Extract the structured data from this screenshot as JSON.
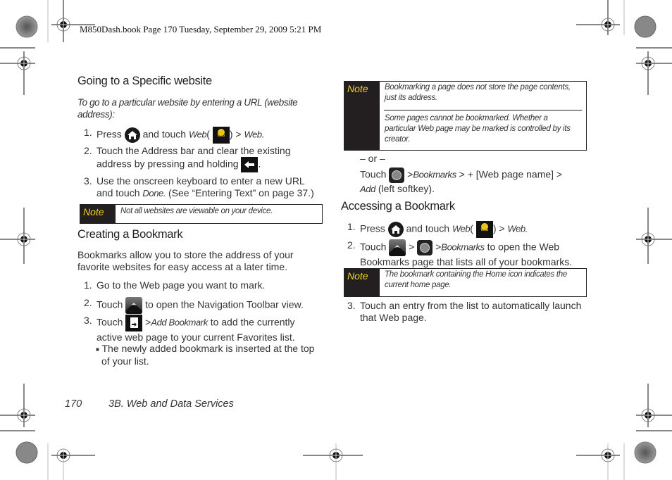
{
  "slug": "M850Dash.book  Page 170  Tuesday, September 29, 2009  5:21 PM",
  "left": {
    "section1": {
      "heading": "Going to a Specific website",
      "intro_line1": "To go to a particular website by entering a URL (website",
      "intro_line2": "address):",
      "steps": [
        {
          "num": "1.",
          "a": "Press",
          "b": "and touch",
          "c": "Web",
          "d": "(",
          "e": ") >",
          "f": "Web."
        },
        {
          "num": "2.",
          "line1": "Touch the Address bar and clear the existing",
          "line2": "address by pressing and holding",
          "end": "."
        },
        {
          "num": "3.",
          "line1": "Use the onscreen keyboard to enter a new URL",
          "line2a": "and touch",
          "line2b": "Done.",
          "line2c": "(See “Entering Text” on page 37.)"
        }
      ],
      "note": {
        "label": "Note",
        "text": "Not all websites are viewable on your device."
      }
    },
    "section2": {
      "heading": "Creating a Bookmark",
      "para_line1": "Bookmarks allow you to store the address of your",
      "para_line2": "favorite websites for easy access at a later time.",
      "steps": [
        {
          "num": "1.",
          "text": "Go to the Web page you want to mark."
        },
        {
          "num": "2.",
          "a": "Touch",
          "b": "to open the Navigation Toolbar view."
        },
        {
          "num": "3.",
          "a": "Touch",
          "b": ">",
          "c": "Add Bookmark",
          "d": "to add the currently",
          "line2": "active web page to your current Favorites list."
        }
      ],
      "bullet_line1": "The newly added bookmark is inserted at the top",
      "bullet_line2": "of your list."
    }
  },
  "right": {
    "note1": {
      "label": "Note",
      "text1": "Bookmarking a page does not store the page contents, just its address.",
      "text2": "Some pages cannot be bookmarked. Whether a particular Web page may be marked is controlled by its creator."
    },
    "or": "– or –",
    "alt_a": "Touch",
    "alt_b": ">",
    "alt_c": "Bookmarks",
    "alt_d": "> + [Web page name] >",
    "alt_e": "Add",
    "alt_f": "(left softkey).",
    "section3": {
      "heading": "Accessing a Bookmark",
      "steps": [
        {
          "num": "1.",
          "a": "Press",
          "b": "and touch",
          "c": "Web",
          "d": "(",
          "e": ") >",
          "f": "Web."
        },
        {
          "num": "2.",
          "a": "Touch",
          "b": ">",
          "c": ">",
          "d": "Bookmarks",
          "e": "to open the Web",
          "line2": "Bookmarks page that lists all of your bookmarks."
        },
        {
          "num": "3.",
          "line1": "Touch an entry from the list to automatically launch",
          "line2": "that Web page."
        }
      ],
      "note": {
        "label": "Note",
        "text": "The bookmark containing the Home icon indicates the current home page."
      }
    }
  },
  "footer": {
    "page": "170",
    "section": "3B. Web and Data Services"
  },
  "colors": {
    "note_label": "#f2d21c",
    "note_bg": "#231f20"
  }
}
